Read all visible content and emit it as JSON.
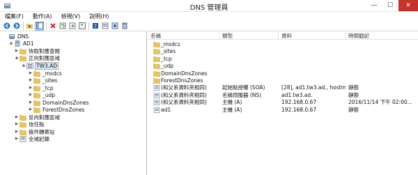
{
  "window": {
    "title": "DNS 管理員",
    "minimize": "—",
    "maximize": "☐",
    "close": "✕"
  },
  "menu": [
    "檔案(F)",
    "動作(A)",
    "檢視(V)",
    "說明(H)"
  ],
  "toolbar": [
    "back-arrow-icon",
    "forward-arrow-icon",
    "folder-up-icon",
    "show-tree-icon",
    "delete-icon",
    "refresh-icon",
    "export-list-icon",
    "help-icon",
    "properties-icon",
    "new-record-icon",
    "new-zone-icon",
    "server-icon"
  ],
  "tree": [
    {
      "label": "DNS",
      "level": 0,
      "icon": "dns",
      "arrow": ""
    },
    {
      "label": "AD1",
      "level": 1,
      "icon": "server",
      "arrow": "▲"
    },
    {
      "label": "快取對應查閱",
      "level": 2,
      "icon": "folder",
      "arrow": "▶"
    },
    {
      "label": "正向對應區域",
      "level": 2,
      "icon": "folder",
      "arrow": "▲"
    },
    {
      "label": "TW3.AD",
      "level": 3,
      "icon": "zone",
      "arrow": "▲",
      "selected": true
    },
    {
      "label": "_msdcs",
      "level": 4,
      "icon": "folder",
      "arrow": "▶"
    },
    {
      "label": "_sites",
      "level": 4,
      "icon": "folder",
      "arrow": "▶"
    },
    {
      "label": "_tcp",
      "level": 4,
      "icon": "folder",
      "arrow": "▶"
    },
    {
      "label": "_udp",
      "level": 4,
      "icon": "folder",
      "arrow": "▶"
    },
    {
      "label": "DomainDnsZones",
      "level": 4,
      "icon": "folder",
      "arrow": "▶"
    },
    {
      "label": "ForestDnsZones",
      "level": 4,
      "icon": "folder",
      "arrow": "▶"
    },
    {
      "label": "反向對應區域",
      "level": 2,
      "icon": "folder",
      "arrow": "▶"
    },
    {
      "label": "信任點",
      "level": 2,
      "icon": "folder",
      "arrow": "▶"
    },
    {
      "label": "條件轉寄站",
      "level": 2,
      "icon": "folder",
      "arrow": "▶"
    },
    {
      "label": "全域記錄",
      "level": 2,
      "icon": "log",
      "arrow": "▶"
    }
  ],
  "columns": [
    "名稱",
    "類型",
    "資料",
    "時間戳記"
  ],
  "rows": [
    {
      "icon": "folder",
      "name": "_msdcs",
      "type": "",
      "data": "",
      "time": ""
    },
    {
      "icon": "folder",
      "name": "_sites",
      "type": "",
      "data": "",
      "time": ""
    },
    {
      "icon": "folder",
      "name": "_tcp",
      "type": "",
      "data": "",
      "time": ""
    },
    {
      "icon": "folder",
      "name": "_udp",
      "type": "",
      "data": "",
      "time": ""
    },
    {
      "icon": "folder",
      "name": "DomainDnsZones",
      "type": "",
      "data": "",
      "time": ""
    },
    {
      "icon": "folder",
      "name": "ForestDnsZones",
      "type": "",
      "data": "",
      "time": ""
    },
    {
      "icon": "record",
      "name": "(和父系資料夾相同)",
      "type": "起始點授權 (SOA)",
      "data": "[28], ad1.tw3.ad., hostm...",
      "time": "靜態"
    },
    {
      "icon": "record",
      "name": "(和父系資料夾相同)",
      "type": "名稱伺服器 (NS)",
      "data": "ad1.tw3.ad.",
      "time": "靜態"
    },
    {
      "icon": "record",
      "name": "(和父系資料夾相同)",
      "type": "主機 (A)",
      "data": "192.168.0.67",
      "time": "2016/11/14 下午 02:00..."
    },
    {
      "icon": "record",
      "name": "ad1",
      "type": "主機 (A)",
      "data": "192.168.0.67",
      "time": "靜態"
    }
  ]
}
